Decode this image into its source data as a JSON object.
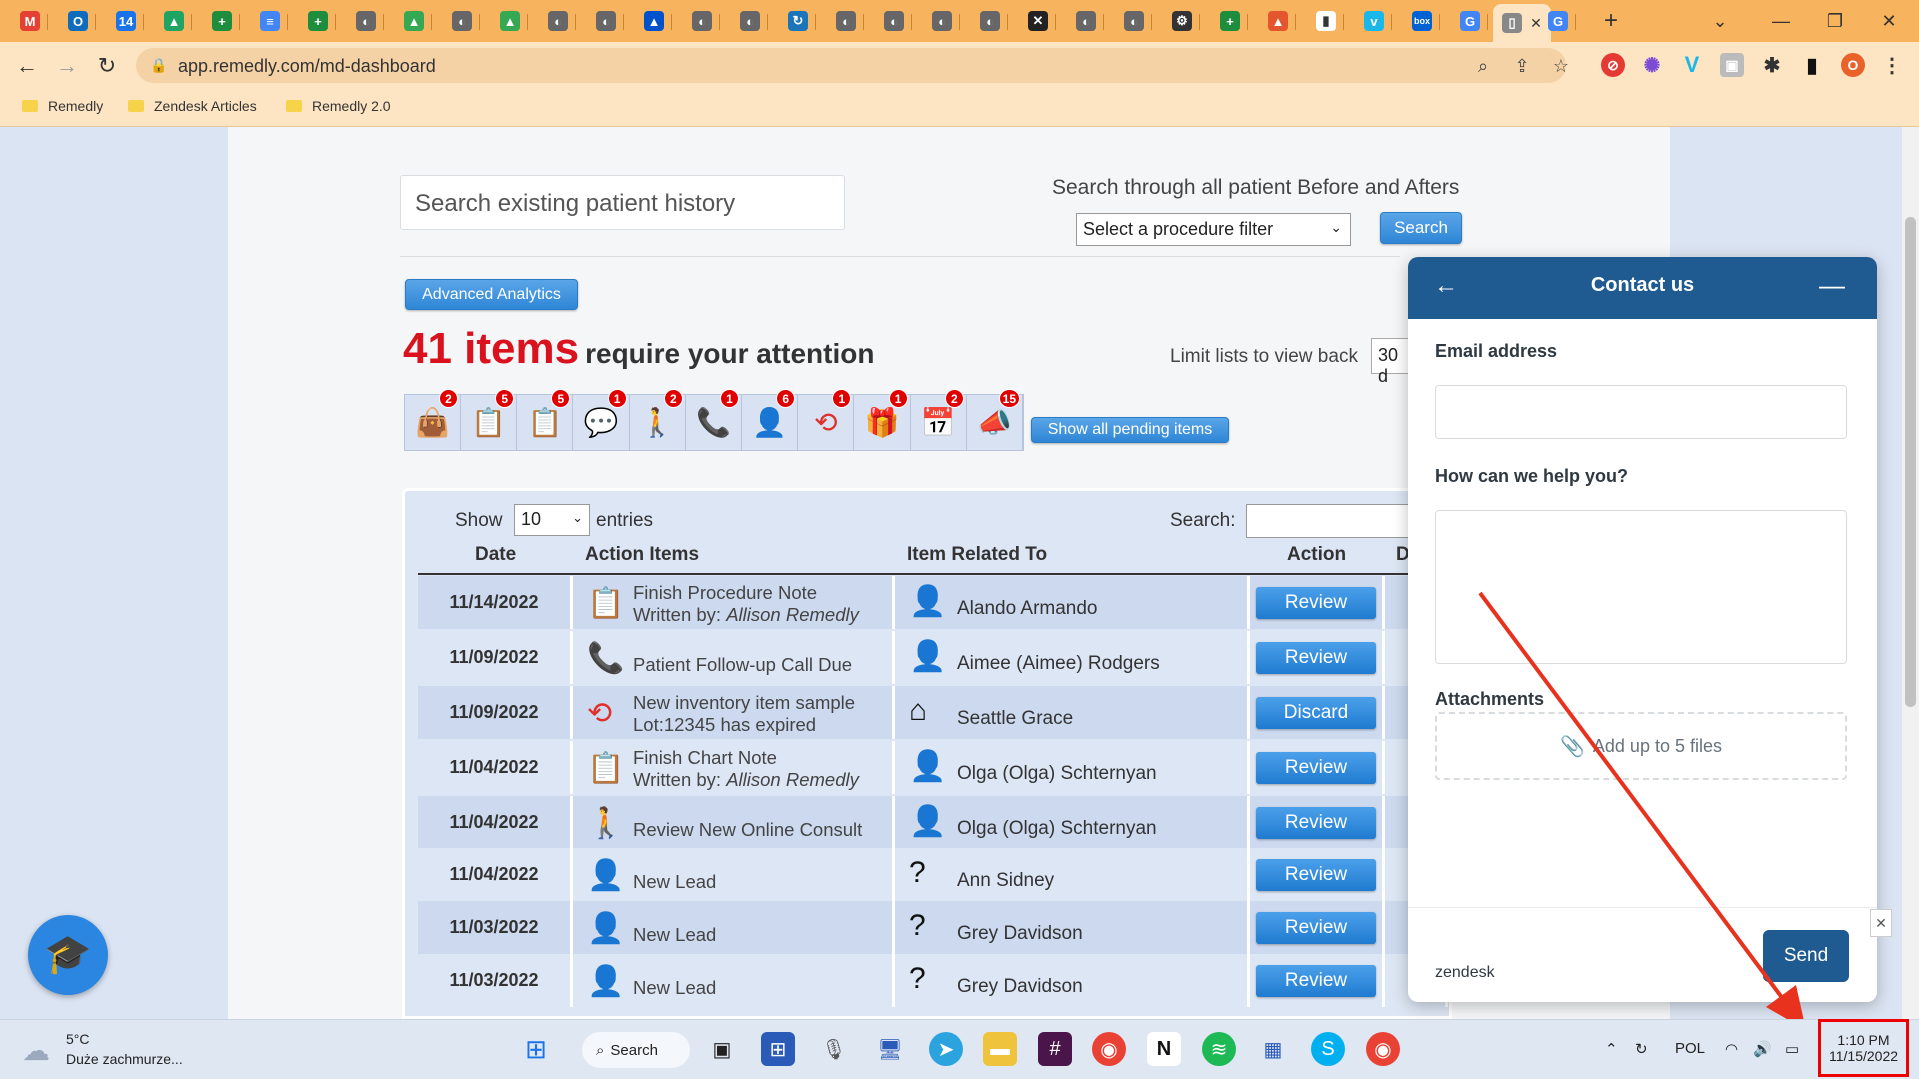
{
  "browser": {
    "tabs": [
      {
        "icon": "gmail-icon",
        "letter": "M",
        "color": "#e44134"
      },
      {
        "icon": "outlook-icon",
        "letter": "O",
        "color": "#0f6cbd"
      },
      {
        "icon": "calendar-icon",
        "letter": "14",
        "color": "#1a73e8"
      },
      {
        "icon": "drive-icon",
        "letter": "▲",
        "color": "#1fa463"
      },
      {
        "icon": "sheets-icon",
        "letter": "+",
        "color": "#1e8e3e"
      },
      {
        "icon": "docs-icon",
        "letter": "≡",
        "color": "#4285f4"
      },
      {
        "icon": "sheets-icon",
        "letter": "+",
        "color": "#1e8e3e"
      },
      {
        "icon": "globe-icon",
        "letter": "◐",
        "color": "#666"
      },
      {
        "icon": "ads-icon",
        "letter": "▲",
        "color": "#34a853"
      },
      {
        "icon": "globe-icon",
        "letter": "◐",
        "color": "#666"
      },
      {
        "icon": "ads-icon",
        "letter": "▲",
        "color": "#34a853"
      },
      {
        "icon": "globe-icon",
        "letter": "◐",
        "color": "#666"
      },
      {
        "icon": "globe-icon",
        "letter": "◐",
        "color": "#666"
      },
      {
        "icon": "atlassian-icon",
        "letter": "▲",
        "color": "#0052cc"
      },
      {
        "icon": "globe-icon",
        "letter": "◐",
        "color": "#666"
      },
      {
        "icon": "globe-icon",
        "letter": "◐",
        "color": "#666"
      },
      {
        "icon": "loop-icon",
        "letter": "↻",
        "color": "#1b75bb"
      },
      {
        "icon": "globe-icon",
        "letter": "◐",
        "color": "#666"
      },
      {
        "icon": "globe-icon",
        "letter": "◐",
        "color": "#666"
      },
      {
        "icon": "globe-icon",
        "letter": "◐",
        "color": "#666"
      },
      {
        "icon": "globe-icon",
        "letter": "◐",
        "color": "#666"
      },
      {
        "icon": "x-tool-icon",
        "letter": "✕",
        "color": "#222"
      },
      {
        "icon": "globe-icon",
        "letter": "◐",
        "color": "#666"
      },
      {
        "icon": "globe-icon",
        "letter": "◐",
        "color": "#666"
      },
      {
        "icon": "gear-icon",
        "letter": "⚙",
        "color": "#333"
      },
      {
        "icon": "sheets-icon",
        "letter": "+",
        "color": "#1e8e3e"
      },
      {
        "icon": "stack-icon",
        "letter": "▲",
        "color": "#e4572e"
      },
      {
        "icon": "notes-icon",
        "letter": "▮",
        "color": "#ffffff"
      },
      {
        "icon": "vimeo-icon",
        "letter": "v",
        "color": "#1ab7ea"
      },
      {
        "icon": "box-icon",
        "letter": "box",
        "color": "#0061d5"
      },
      {
        "icon": "google-icon",
        "letter": "G",
        "color": "#4285f4"
      },
      {
        "icon": "page-icon",
        "letter": "▯",
        "color": "#888"
      },
      {
        "icon": "google-icon",
        "letter": "G",
        "color": "#4285f4"
      }
    ],
    "active_tab_close": "✕",
    "new_tab": "+",
    "url": "app.remedly.com/md-dashboard",
    "bookmarks": [
      "Remedly",
      "Zendesk Articles",
      "Remedly 2.0"
    ],
    "profile_initial": "O"
  },
  "dashboard": {
    "search_placeholder": "Search existing patient history",
    "before_after_title": "Search through all patient Before and Afters",
    "procedure_filter": "Select a procedure filter",
    "search_button": "Search",
    "analytics_button": "Advanced Analytics",
    "attention_count": "41 items",
    "attention_text": "require your attention",
    "limit_label": "Limit lists to view back",
    "limit_value": "30 d",
    "icon_strip": [
      {
        "icon": "shopping-bag-icon",
        "glyph": "👜",
        "count": "2",
        "color": "#111"
      },
      {
        "icon": "clipboard-add-icon",
        "glyph": "📋",
        "count": "5",
        "color": "#e0302a"
      },
      {
        "icon": "clipboard-check-icon",
        "glyph": "📋",
        "count": "5",
        "color": "#8e2fbf"
      },
      {
        "icon": "chat-icon",
        "glyph": "💬",
        "count": "1",
        "color": "#1f8a3a"
      },
      {
        "icon": "walk-in-icon",
        "glyph": "🚶",
        "count": "2",
        "color": "#1f8a3a"
      },
      {
        "icon": "phone-ring-icon",
        "glyph": "📞",
        "count": "1",
        "color": "#e0302a"
      },
      {
        "icon": "lead-icon",
        "glyph": "👤",
        "count": "6",
        "color": "#2a86e0"
      },
      {
        "icon": "expired-icon",
        "glyph": "⟲",
        "count": "1",
        "color": "#e0302a"
      },
      {
        "icon": "gift-icon",
        "glyph": "🎁",
        "count": "1",
        "color": "#8e2fbf"
      },
      {
        "icon": "calendar-icon",
        "glyph": "📅",
        "count": "2",
        "color": "#2a86e0"
      },
      {
        "icon": "review-stand-icon",
        "glyph": "📣",
        "count": "15",
        "color": "#111"
      }
    ],
    "show_pending_button": "Show all pending items",
    "table": {
      "show_label": "Show",
      "entries_value": "10",
      "entries_label": "entries",
      "search_label": "Search:",
      "headers": [
        "Date",
        "Action Items",
        "Item Related To",
        "Action",
        "D"
      ],
      "rows": [
        {
          "date": "11/14/2022",
          "icon": "clipboard-check-icon",
          "glyph": "📋",
          "icon_color": "#8e2fbf",
          "line1": "Finish Procedure Note",
          "line2_prefix": "Written by: ",
          "line2_author": "Allison Remedly",
          "rel_icon": "patient-icon",
          "rel_glyph": "👤",
          "related": "Alando Armando",
          "action": "Review"
        },
        {
          "date": "11/09/2022",
          "icon": "phone-ring-icon",
          "glyph": "📞",
          "icon_color": "#e0302a",
          "line1": "Patient Follow-up Call Due",
          "line2_prefix": "",
          "line2_author": "",
          "rel_icon": "patient-icon",
          "rel_glyph": "👤",
          "related": "Aimee (Aimee) Rodgers",
          "action": "Review"
        },
        {
          "date": "11/09/2022",
          "icon": "expired-icon",
          "glyph": "⟲",
          "icon_color": "#e0302a",
          "line1": "New inventory item sample",
          "line2_prefix": "Lot:12345 has expired",
          "line2_author": "",
          "rel_icon": "clinic-icon",
          "rel_glyph": "⌂",
          "related": "Seattle Grace",
          "action": "Discard"
        },
        {
          "date": "11/04/2022",
          "icon": "clipboard-check-icon",
          "glyph": "📋",
          "icon_color": "#8e2fbf",
          "line1": "Finish Chart Note",
          "line2_prefix": "Written by: ",
          "line2_author": "Allison Remedly",
          "rel_icon": "patient-icon",
          "rel_glyph": "👤",
          "related": "Olga (Olga) Schternyan",
          "action": "Review"
        },
        {
          "date": "11/04/2022",
          "icon": "walk-in-icon",
          "glyph": "🚶",
          "icon_color": "#1f8a3a",
          "line1": "Review New Online Consult",
          "line2_prefix": "",
          "line2_author": "",
          "rel_icon": "patient-icon",
          "rel_glyph": "👤",
          "related": "Olga (Olga) Schternyan",
          "action": "Review"
        },
        {
          "date": "11/04/2022",
          "icon": "lead-icon",
          "glyph": "👤",
          "icon_color": "#2a86e0",
          "line1": "New Lead",
          "line2_prefix": "",
          "line2_author": "",
          "rel_icon": "unknown-patient-icon",
          "rel_glyph": "?",
          "related": "Ann Sidney",
          "action": "Review"
        },
        {
          "date": "11/03/2022",
          "icon": "lead-icon",
          "glyph": "👤",
          "icon_color": "#2a86e0",
          "line1": "New Lead",
          "line2_prefix": "",
          "line2_author": "",
          "rel_icon": "unknown-patient-icon",
          "rel_glyph": "?",
          "related": "Grey Davidson",
          "action": "Review"
        },
        {
          "date": "11/03/2022",
          "icon": "lead-icon",
          "glyph": "👤",
          "icon_color": "#2a86e0",
          "line1": "New Lead",
          "line2_prefix": "",
          "line2_author": "",
          "rel_icon": "unknown-patient-icon",
          "rel_glyph": "?",
          "related": "Grey Davidson",
          "action": "Review"
        }
      ]
    }
  },
  "zendesk": {
    "title": "Contact us",
    "email_label": "Email address",
    "help_label": "How can we help you?",
    "attachments_label": "Attachments",
    "attach_text": "Add up to 5 files",
    "brand": "zendesk",
    "send": "Send"
  },
  "taskbar": {
    "temp": "5°C",
    "weather": "Duże zachmurze...",
    "search": "Search",
    "lang": "POL",
    "time": "1:10 PM",
    "date": "11/15/2022",
    "chrome_badge_1": "0",
    "chrome_badge_2": "0"
  },
  "colors": {
    "tabbar": "#f7b35d",
    "zendesk_header": "#1f5a90",
    "attention_red": "#d9121e",
    "annotation_red": "#e8321e"
  }
}
